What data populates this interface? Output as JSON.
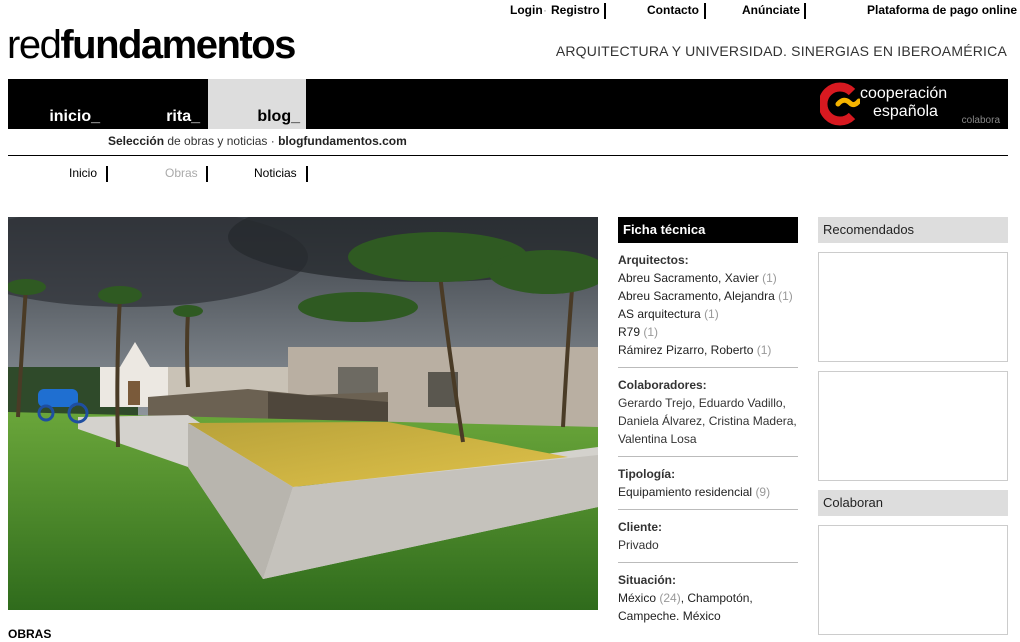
{
  "toplinks": {
    "login": "Login",
    "sep": "·",
    "registro": "Registro",
    "contacto": "Contacto",
    "anunciate": "Anúnciate",
    "plataforma": "Plataforma de pago online"
  },
  "logo": {
    "light": "red",
    "bold": "fundamentos"
  },
  "tagline": "ARQUITECTURA Y UNIVERSIDAD. SINERGIAS EN IBEROAMÉRICA",
  "nav": {
    "tabs": [
      "inicio_",
      "rita_",
      "blog_"
    ],
    "active": "blog_",
    "sponsor_line1": "cooperación",
    "sponsor_line2": "española",
    "sponsor_tag": "colabora"
  },
  "subtitle": {
    "bold1": "Selección",
    "mid": " de obras y noticias · ",
    "bold2": "blogfundamentos.com"
  },
  "subnav": [
    {
      "label": "Inicio",
      "active": true
    },
    {
      "label": "Obras",
      "active": false
    },
    {
      "label": "Noticias",
      "active": true
    }
  ],
  "section_label": "OBRAS",
  "ficha": {
    "title": "Ficha técnica",
    "arquitectos_title": "Arquitectos:",
    "arquitectos": [
      {
        "name": "Abreu Sacramento, Xavier",
        "count": "(1)"
      },
      {
        "name": "Abreu Sacramento, Alejandra",
        "count": "(1)"
      },
      {
        "name": "AS arquitectura",
        "count": "(1)"
      },
      {
        "name": "R79",
        "count": "(1)"
      },
      {
        "name": "Rámirez Pizarro, Roberto",
        "count": "(1)"
      }
    ],
    "colaboradores_title": "Colaboradores:",
    "colaboradores": "Gerardo Trejo, Eduardo Vadillo, Daniela Álvarez, Cristina Madera, Valentina Losa",
    "tipologia_title": "Tipología:",
    "tipologia": {
      "name": "Equipamiento residencial",
      "count": "(9)"
    },
    "cliente_title": "Cliente:",
    "cliente": "Privado",
    "situacion_title": "Situación:",
    "situacion": {
      "a": "México",
      "a_count": "(24)",
      "b": ", Champotón, Campeche. México"
    }
  },
  "right": {
    "recomendados": "Recomendados",
    "colaboran": "Colaboran"
  },
  "colors": {
    "black": "#000000",
    "grey_tab": "#dddddd",
    "coop_red": "#d71920",
    "coop_yellow": "#f5b400"
  }
}
